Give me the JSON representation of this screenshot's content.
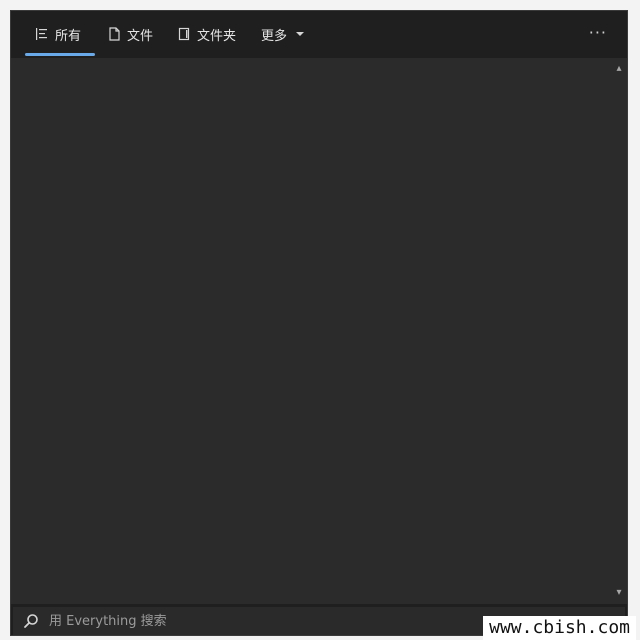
{
  "tabs": [
    {
      "label": "所有",
      "icon": "list-icon",
      "active": true
    },
    {
      "label": "文件",
      "icon": "file-icon",
      "active": false
    },
    {
      "label": "文件夹",
      "icon": "folder-icon",
      "active": false
    },
    {
      "label": "更多",
      "icon": "chevron-down-icon",
      "active": false
    }
  ],
  "more_menu": {
    "label": "···"
  },
  "search": {
    "placeholder": "用 Everything 搜索"
  },
  "watermark": {
    "text": "www.cbish.com"
  },
  "colors": {
    "background": "#2b2b2b",
    "tabbar": "#1f1f1f",
    "accent": "#6aa9e9",
    "text": "#e6e6e6"
  }
}
